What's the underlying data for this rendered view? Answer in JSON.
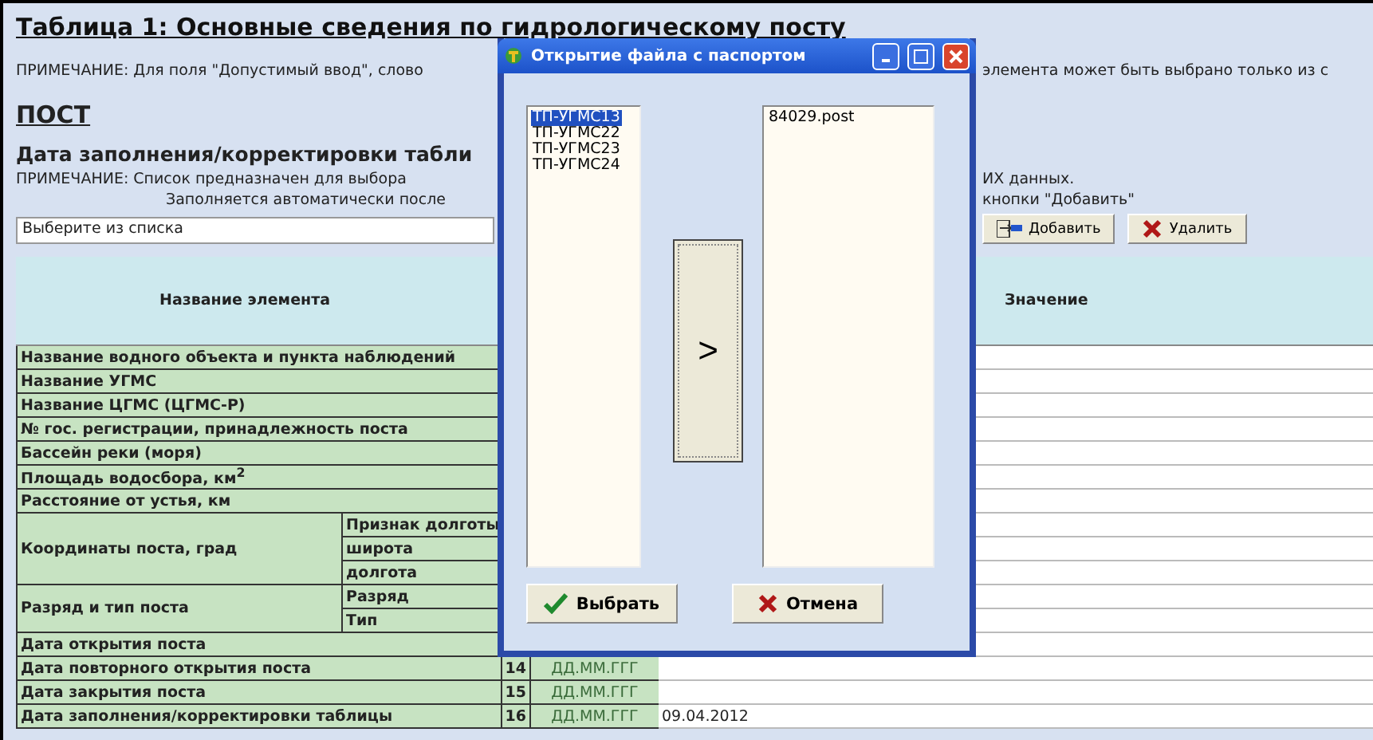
{
  "page": {
    "title": "Таблица 1: Основные сведения по гидрологическому посту",
    "note_left": "ПРИМЕЧАНИЕ: Для поля \"Допустимый ввод\", слово",
    "note_right": "элемента может быть выбрано только из с",
    "section": "ПОСТ",
    "subtitle": "Дата заполнения/корректировки табли",
    "note2_left": [
      "ПРИМЕЧАНИЕ: Список предназначен для выбора",
      "Заполняется автоматически после"
    ],
    "note2_right": [
      "ИХ данных.",
      "кнопки \"Добавить\""
    ],
    "select": {
      "value": "Выберите из списка"
    },
    "buttons": [
      {
        "label": "Добавить",
        "kind": "add"
      },
      {
        "label": "Удалить",
        "kind": "delete"
      }
    ]
  },
  "table": {
    "columns": [
      "Название элемента",
      "Значение"
    ],
    "rows": [
      {
        "name": "Название водного объекта и пункта наблюдений"
      },
      {
        "name": "Название УГМС"
      },
      {
        "name": "Название ЦГМС (ЦГМС-Р)"
      },
      {
        "name": "№ гос. регистрации, принадлежность поста"
      },
      {
        "name": "Бассейн реки (моря)"
      },
      {
        "name": "Площадь водосбора, км$^{2}$"
      },
      {
        "name": "Расстояние от устья, км"
      },
      {
        "name": "Координаты поста, град",
        "subs": [
          "Признак долготы",
          "широта",
          "долгота"
        ]
      },
      {
        "name": "Разряд и тип поста",
        "subs": [
          "Разряд",
          "Тип"
        ]
      },
      {
        "name": "Дата открытия поста"
      },
      {
        "name": "Дата повторного открытия поста",
        "number": "14",
        "format": "ДД.ММ.ГГГ"
      },
      {
        "name": "Дата закрытия поста",
        "number": "15",
        "format": "ДД.ММ.ГГГ"
      },
      {
        "name": "Дата заполнения/корректировки таблицы",
        "number": "16",
        "format": "ДД.ММ.ГГГ",
        "value": "09.04.2012"
      }
    ]
  },
  "dialog": {
    "title": "Открытие файла с паспортом",
    "left_list": [
      {
        "label": "ТП-УГМС13",
        "selected": true
      },
      {
        "label": "ТП-УГМС22",
        "selected": false
      },
      {
        "label": "ТП-УГМС23",
        "selected": false
      },
      {
        "label": "ТП-УГМС24",
        "selected": false
      }
    ],
    "move_button": ">",
    "right_list": [
      "84029.post"
    ],
    "buttons": [
      {
        "label": "Выбрать",
        "kind": "ok"
      },
      {
        "label": "Отмена",
        "kind": "cancel"
      }
    ]
  }
}
